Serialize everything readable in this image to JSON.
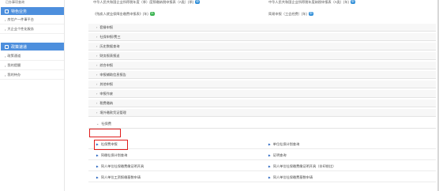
{
  "sidebar": {
    "cut_text": "已办事项查询",
    "section1": "特色业务",
    "section1_items": [
      "房信产一件事平台",
      "大企业个性化服务"
    ],
    "section2": "政策速递",
    "section2_items": [
      "政策通道",
      "我的提醒",
      "我的待办"
    ]
  },
  "top": {
    "row1_left": "中华人民共和国企业所得税年度（季）度预缴纳税申报表（A类）(季)",
    "row1_left_badge": "申",
    "row1_right": "中华人民共和国企业所得税年度纳税申报表（A类）(年)",
    "row1_right_badge": "申",
    "row2_left": "《残疾人就业保障金缴费申报表》(年)",
    "row2_left_badge": "21",
    "row2_right": "简易申报（工会经费）(年)",
    "row2_right_badge": "申"
  },
  "categories": [
    "套餐申报",
    "社保申报/费三",
    "历史数据查询",
    "财务报表报送",
    "综合申报",
    "申报辅助信息报告",
    "其他申报",
    "申报作废",
    "税费缴纳",
    "境外缴款凭证管理"
  ],
  "expanded_category": "社保费",
  "sub_items": [
    {
      "left": "社保费申报",
      "right": "单位社保计划查询"
    },
    {
      "left": "同缴社保计划查询",
      "right": "证明查询"
    },
    {
      "left": "同人单位社保缴费缴证明开具",
      "right": "同人单位社保缴费缴证明开具（非印前比）"
    },
    {
      "left": "同人单位工资报缴基数申请",
      "right": "同人单位社保缴费基数申请"
    }
  ],
  "colors": {
    "sidebar_header": "#4d8fdd",
    "highlight": "#e01c1c",
    "link_triangle": "#1f5fbf"
  }
}
